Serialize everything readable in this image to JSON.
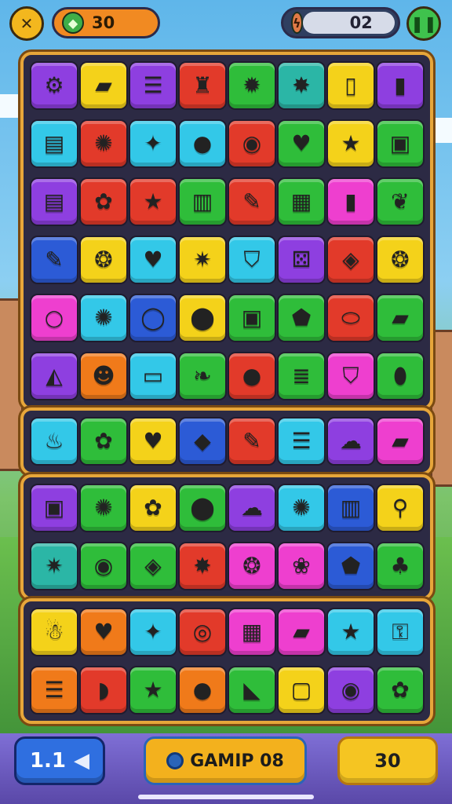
{
  "top_bar": {
    "close_icon": "close-x-icon",
    "coins": {
      "icon": "gem-icon",
      "value": "30"
    },
    "moves": {
      "icon": "lightning-icon",
      "value": "02"
    },
    "pause_icon": "pause-icon"
  },
  "bottom_bar": {
    "level_label": "1.1",
    "level_arrow_icon": "arrow-left-icon",
    "game_label": "GAMIP 08",
    "score_label": "30"
  },
  "colors": {
    "purple": "#8e3fe0",
    "yellow": "#f4d21a",
    "orange": "#f07a1a",
    "red": "#e23a2a",
    "green": "#2fbd3a",
    "cyan": "#33c8e8",
    "blue": "#2c5bd6",
    "pink": "#ee3fcf",
    "teal": "#2bb6a6"
  },
  "boards": [
    {
      "rows": [
        [
          {
            "c": "purple",
            "icon": "gear-icon",
            "g": "⚙"
          },
          {
            "c": "yellow",
            "icon": "eraser-icon",
            "g": "▰"
          },
          {
            "c": "purple",
            "icon": "cookie-stack-icon",
            "g": "☰"
          },
          {
            "c": "red",
            "icon": "bell-icon",
            "g": "♜"
          },
          {
            "c": "green",
            "icon": "sun-icon",
            "g": "✹"
          },
          {
            "c": "teal",
            "icon": "star-badge-icon",
            "g": "✸"
          },
          {
            "c": "yellow",
            "icon": "phone-icon",
            "g": "▯"
          },
          {
            "c": "purple",
            "icon": "battery-icon",
            "g": "▮"
          }
        ],
        [
          {
            "c": "cyan",
            "icon": "book-stack-icon",
            "g": "▤"
          },
          {
            "c": "red",
            "icon": "sunflower-icon",
            "g": "✺"
          },
          {
            "c": "cyan",
            "icon": "star-blob-icon",
            "g": "✦"
          },
          {
            "c": "cyan",
            "icon": "ball-icon",
            "g": "●"
          },
          {
            "c": "red",
            "icon": "donut-icon",
            "g": "◉"
          },
          {
            "c": "green",
            "icon": "berry-icon",
            "g": "♥"
          },
          {
            "c": "yellow",
            "icon": "star-icon",
            "g": "★"
          },
          {
            "c": "green",
            "icon": "jar-icon",
            "g": "▣"
          }
        ],
        [
          {
            "c": "purple",
            "icon": "sandwich-icon",
            "g": "▤"
          },
          {
            "c": "red",
            "icon": "flower-icon",
            "g": "✿"
          },
          {
            "c": "red",
            "icon": "star-icon",
            "g": "★"
          },
          {
            "c": "green",
            "icon": "cup-icon",
            "g": "▥"
          },
          {
            "c": "red",
            "icon": "pencil-icon",
            "g": "✎"
          },
          {
            "c": "green",
            "icon": "lantern-icon",
            "g": "▦"
          },
          {
            "c": "pink",
            "icon": "battery-icon",
            "g": "▮"
          },
          {
            "c": "green",
            "icon": "leaf-icon",
            "g": "❦"
          }
        ],
        [
          {
            "c": "blue",
            "icon": "pencil-icon",
            "g": "✎"
          },
          {
            "c": "yellow",
            "icon": "balloon-icon",
            "g": "❂"
          },
          {
            "c": "cyan",
            "icon": "heart-icon",
            "g": "♥"
          },
          {
            "c": "yellow",
            "icon": "spark-icon",
            "g": "✷"
          },
          {
            "c": "cyan",
            "icon": "shield-icon",
            "g": "⛉"
          },
          {
            "c": "purple",
            "icon": "dice-icon",
            "g": "⚄"
          },
          {
            "c": "red",
            "icon": "popsicle-icon",
            "g": "◈"
          },
          {
            "c": "yellow",
            "icon": "potion-icon",
            "g": "❂"
          }
        ],
        [
          {
            "c": "pink",
            "icon": "ring-icon",
            "g": "○"
          },
          {
            "c": "cyan",
            "icon": "splat-icon",
            "g": "✺"
          },
          {
            "c": "blue",
            "icon": "ring-icon",
            "g": "◯"
          },
          {
            "c": "yellow",
            "icon": "map-pin-icon",
            "g": "⬤"
          },
          {
            "c": "green",
            "icon": "robot-icon",
            "g": "▣"
          },
          {
            "c": "green",
            "icon": "gem-icon",
            "g": "⬟"
          },
          {
            "c": "red",
            "icon": "pill-icon",
            "g": "⬭"
          },
          {
            "c": "green",
            "icon": "candy-bar-icon",
            "g": "▰"
          }
        ],
        [
          {
            "c": "purple",
            "icon": "cheese-icon",
            "g": "◭"
          },
          {
            "c": "orange",
            "icon": "mask-icon",
            "g": "☻"
          },
          {
            "c": "cyan",
            "icon": "card-icon",
            "g": "▭"
          },
          {
            "c": "green",
            "icon": "leaf-icon",
            "g": "❧"
          },
          {
            "c": "red",
            "icon": "face-blob-icon",
            "g": "●"
          },
          {
            "c": "green",
            "icon": "coin-stack-icon",
            "g": "≣"
          },
          {
            "c": "pink",
            "icon": "shield-icon",
            "g": "⛉"
          },
          {
            "c": "green",
            "icon": "capsule-icon",
            "g": "⬮"
          }
        ]
      ]
    },
    {
      "rows": [
        [
          {
            "c": "cyan",
            "icon": "fries-icon",
            "g": "♨"
          },
          {
            "c": "green",
            "icon": "gift-icon",
            "g": "✿"
          },
          {
            "c": "yellow",
            "icon": "heart-blob-icon",
            "g": "♥"
          },
          {
            "c": "blue",
            "icon": "diamond-icon",
            "g": "◆"
          },
          {
            "c": "red",
            "icon": "pencil-icon",
            "g": "✎"
          },
          {
            "c": "cyan",
            "icon": "book-stack-icon",
            "g": "☰"
          },
          {
            "c": "purple",
            "icon": "slime-icon",
            "g": "☁"
          },
          {
            "c": "pink",
            "icon": "eraser-icon",
            "g": "▰"
          }
        ]
      ]
    },
    {
      "rows": [
        [
          {
            "c": "purple",
            "icon": "jam-jar-icon",
            "g": "▣"
          },
          {
            "c": "green",
            "icon": "splat-icon",
            "g": "✺"
          },
          {
            "c": "yellow",
            "icon": "flower-icon",
            "g": "✿"
          },
          {
            "c": "green",
            "icon": "map-pin-icon",
            "g": "⬤"
          },
          {
            "c": "purple",
            "icon": "cloud-icon",
            "g": "☁"
          },
          {
            "c": "cyan",
            "icon": "cookie-icon",
            "g": "✺"
          },
          {
            "c": "blue",
            "icon": "rainbow-jar-icon",
            "g": "▥"
          },
          {
            "c": "yellow",
            "icon": "magnifier-icon",
            "g": "⚲"
          }
        ],
        [
          {
            "c": "teal",
            "icon": "splat-icon",
            "g": "✷"
          },
          {
            "c": "green",
            "icon": "donut-icon",
            "g": "◉"
          },
          {
            "c": "green",
            "icon": "candy-icon",
            "g": "◈"
          },
          {
            "c": "red",
            "icon": "spark-icon",
            "g": "✸"
          },
          {
            "c": "pink",
            "icon": "bubble-icon",
            "g": "❂"
          },
          {
            "c": "pink",
            "icon": "egg-icon",
            "g": "❀"
          },
          {
            "c": "blue",
            "icon": "lollipop-icon",
            "g": "⬟"
          },
          {
            "c": "green",
            "icon": "plant-pot-icon",
            "g": "♣"
          }
        ]
      ]
    },
    {
      "rows": [
        [
          {
            "c": "yellow",
            "icon": "robot-icon",
            "g": "☃"
          },
          {
            "c": "orange",
            "icon": "heart-blob-icon",
            "g": "♥"
          },
          {
            "c": "cyan",
            "icon": "star-card-icon",
            "g": "✦"
          },
          {
            "c": "red",
            "icon": "ring-icon",
            "g": "◎"
          },
          {
            "c": "pink",
            "icon": "map-icon",
            "g": "▦"
          },
          {
            "c": "pink",
            "icon": "eraser-icon",
            "g": "▰"
          },
          {
            "c": "cyan",
            "icon": "star-icon",
            "g": "★"
          },
          {
            "c": "cyan",
            "icon": "lock-icon",
            "g": "⚿"
          }
        ],
        [
          {
            "c": "orange",
            "icon": "burger-icon",
            "g": "☰"
          },
          {
            "c": "red",
            "icon": "fish-icon",
            "g": "◗"
          },
          {
            "c": "green",
            "icon": "star-icon",
            "g": "★"
          },
          {
            "c": "orange",
            "icon": "orange-fruit-icon",
            "g": "●"
          },
          {
            "c": "green",
            "icon": "ice-cream-icon",
            "g": "◣"
          },
          {
            "c": "yellow",
            "icon": "box-icon",
            "g": "▢"
          },
          {
            "c": "purple",
            "icon": "donut-icon",
            "g": "◉"
          },
          {
            "c": "green",
            "icon": "flower-icon",
            "g": "✿"
          }
        ]
      ]
    }
  ]
}
